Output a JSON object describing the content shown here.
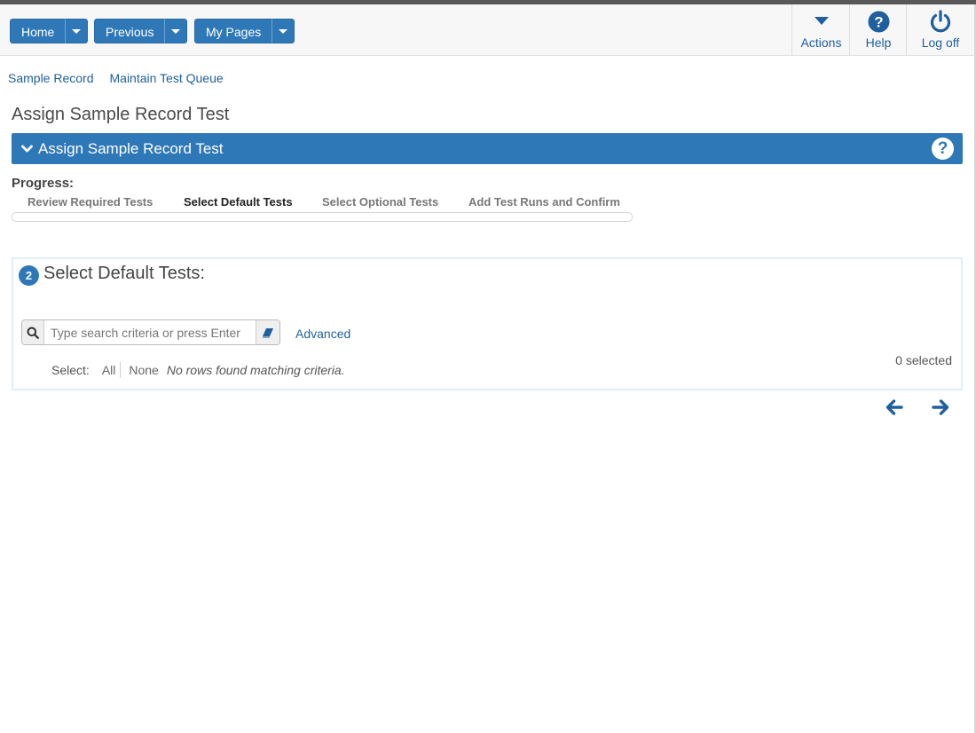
{
  "header": {
    "nav_buttons": [
      {
        "label": "Home"
      },
      {
        "label": "Previous"
      },
      {
        "label": "My Pages"
      }
    ],
    "tools": [
      {
        "label": "Actions",
        "icon": "caret-down-icon"
      },
      {
        "label": "Help",
        "icon": "question-circle-icon"
      },
      {
        "label": "Log off",
        "icon": "power-icon"
      }
    ]
  },
  "breadcrumbs": [
    "Sample Record",
    "Maintain Test Queue"
  ],
  "page_title": "Assign Sample Record Test",
  "section_bar": {
    "title": "Assign Sample Record Test",
    "help_glyph": "?"
  },
  "progress": {
    "label": "Progress:",
    "steps": [
      "Review Required Tests",
      "Select Default Tests",
      "Select Optional Tests",
      "Add Test Runs and Confirm"
    ],
    "active_step": 1
  },
  "panel": {
    "step_number": "2",
    "title": "Select Default Tests:",
    "search": {
      "placeholder": "Type search criteria or press Enter",
      "value": ""
    },
    "advanced_label": "Advanced",
    "selection_count": "0 selected",
    "select_label": "Select:",
    "select_all": "All",
    "select_none": "None",
    "empty_message": "No rows found matching criteria."
  },
  "colors": {
    "primary": "#2f78b8",
    "link": "#1f5f9e"
  }
}
